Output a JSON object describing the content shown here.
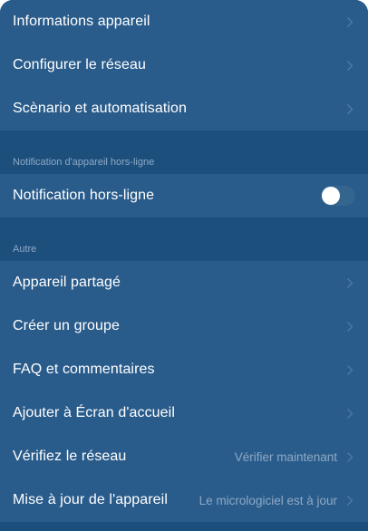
{
  "settings_group_1": {
    "items": [
      {
        "label": "Informations appareil"
      },
      {
        "label": "Configurer le réseau"
      },
      {
        "label": "Scènario et automatisation"
      }
    ]
  },
  "offline_section": {
    "header": "Notification d'appareil hors-ligne",
    "toggle_label": "Notification hors-ligne",
    "toggle_on": false
  },
  "other_section": {
    "header": "Autre",
    "items": [
      {
        "label": "Appareil partagé"
      },
      {
        "label": "Créer un groupe"
      },
      {
        "label": "FAQ et commentaires"
      },
      {
        "label": "Ajouter à Écran d'accueil"
      },
      {
        "label": "Vérifiez le réseau",
        "value": "Vérifier maintenant"
      },
      {
        "label": "Mise à jour de l'appareil",
        "value": "Le micrologiciel est à jour"
      }
    ]
  },
  "icons": {
    "chevron": "chevron-right-icon"
  },
  "colors": {
    "background": "#1d4f7d",
    "row_background": "#2a5c8b",
    "secondary_text": "#8ea9c6",
    "toggle_off": "#34658f"
  }
}
